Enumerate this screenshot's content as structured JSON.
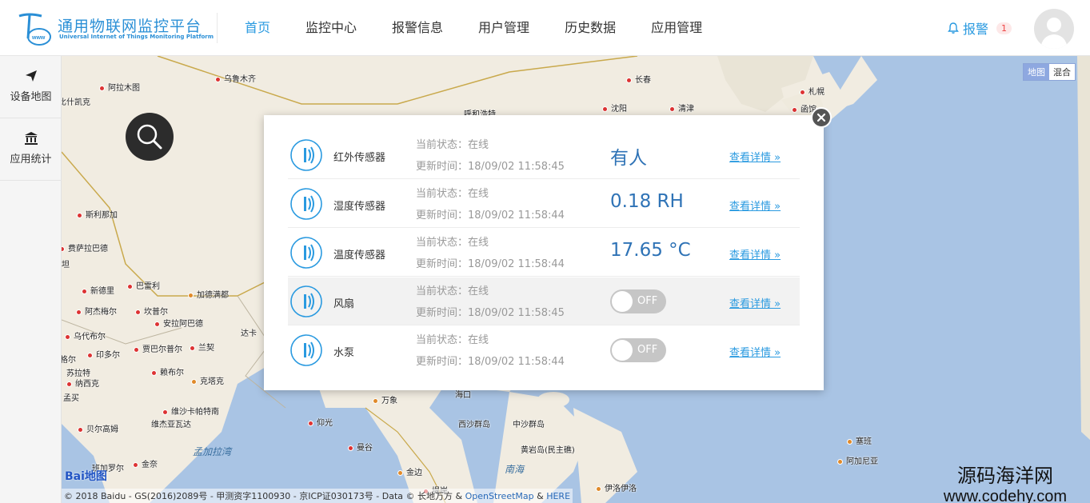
{
  "header": {
    "logo_title": "通用物联网监控平台",
    "logo_subtitle": "Universal Internet of Things Monitoring Platform",
    "nav": [
      "首页",
      "监控中心",
      "报警信息",
      "用户管理",
      "历史数据",
      "应用管理"
    ],
    "active_nav": "首页",
    "alarm_label": "报警",
    "alarm_count": "1"
  },
  "sidebar": {
    "items": [
      {
        "label": "设备地图",
        "icon": "send-icon"
      },
      {
        "label": "应用统计",
        "icon": "bank-icon"
      }
    ]
  },
  "map": {
    "type_buttons": [
      "地图",
      "混合"
    ],
    "active_type": "地图",
    "cities": [
      "乌鲁木齐",
      "阿拉木图",
      "比什凯克",
      "长春",
      "札幌",
      "函馆",
      "呼和浩特",
      "沈阳",
      "清津",
      "斯利那加",
      "费萨拉巴德",
      "坦",
      "新德里",
      "巴雷利",
      "加德满都",
      "阿杰梅尔",
      "坎普尔",
      "安拉阿巴德",
      "乌代布尔",
      "印多尔",
      "贾巴尔普尔",
      "兰契",
      "达卡",
      "格尔",
      "苏拉特",
      "纳西克",
      "孟买",
      "赖布尔",
      "克塔克",
      "维沙卡帕特南",
      "维杰亚瓦达",
      "贝尔高姆",
      "金奈",
      "班加罗尔",
      "万象",
      "仰光",
      "曼谷",
      "金边",
      "堤岸",
      "海口",
      "西沙群岛",
      "中沙群岛",
      "黄岩岛(民主礁)",
      "伊洛伊洛",
      "塞班",
      "阿加尼亚"
    ],
    "seas": [
      "孟加拉湾",
      "南海"
    ],
    "copyright_prefix": "© 2018 Baidu - GS(2016)2089号 - 甲测资字1100930 - 京ICP证030173号 - Data © 长地万方 & ",
    "copyright_osm": "OpenStreetMap",
    "copyright_amp": " & ",
    "copyright_here": "HERE",
    "baidu_logo_a": "Bai",
    "baidu_logo_b": "地图",
    "watermark_cn": "源码海洋网",
    "watermark_en": "www.codehy.com"
  },
  "popup": {
    "status_prefix": "当前状态：",
    "time_prefix": "更新时间：",
    "link_label": "查看详情 »",
    "devices": [
      {
        "name": "红外传感器",
        "status": "在线",
        "time": "18/09/02 11:58:45",
        "value": "有人",
        "kind": "value"
      },
      {
        "name": "湿度传感器",
        "status": "在线",
        "time": "18/09/02 11:58:44",
        "value": "0.18 RH",
        "kind": "value"
      },
      {
        "name": "温度传感器",
        "status": "在线",
        "time": "18/09/02 11:58:44",
        "value": "17.65 °C",
        "kind": "value"
      },
      {
        "name": "风扇",
        "status": "在线",
        "time": "18/09/02 11:58:45",
        "value": "OFF",
        "kind": "toggle"
      },
      {
        "name": "水泵",
        "status": "在线",
        "time": "18/09/02 11:58:44",
        "value": "OFF",
        "kind": "toggle"
      }
    ]
  },
  "colors": {
    "accent": "#2a9ae0",
    "value_blue": "#2f73b6",
    "map_sea": "#a9c4e4",
    "map_land": "#f1ece1"
  }
}
